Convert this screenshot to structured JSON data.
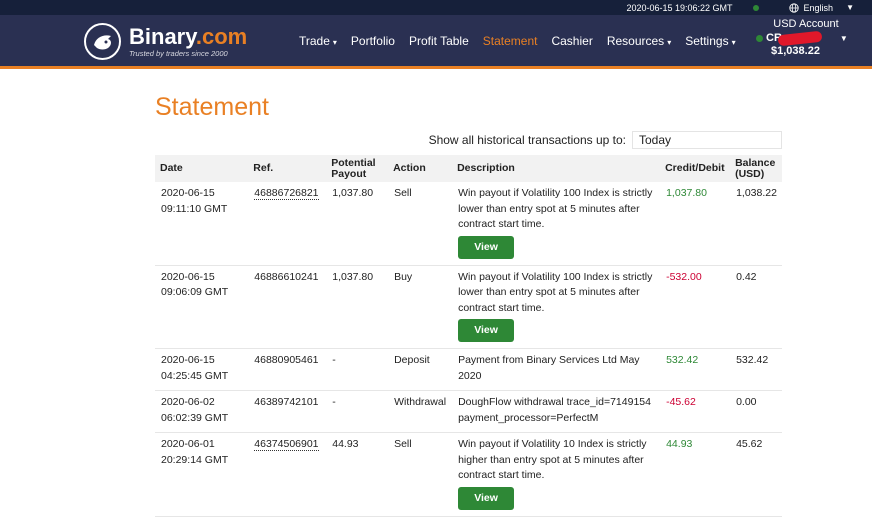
{
  "topbar": {
    "datetime": "2020-06-15 19:06:22 GMT",
    "language": "English"
  },
  "brand": {
    "name": "Binary",
    "suffix": ".com",
    "tagline": "Trusted by traders since 2000"
  },
  "nav": {
    "items": [
      {
        "label": "Trade",
        "dropdown": true,
        "active": false
      },
      {
        "label": "Portfolio",
        "dropdown": false,
        "active": false
      },
      {
        "label": "Profit Table",
        "dropdown": false,
        "active": false
      },
      {
        "label": "Statement",
        "dropdown": false,
        "active": true
      },
      {
        "label": "Cashier",
        "dropdown": false,
        "active": false
      },
      {
        "label": "Resources",
        "dropdown": true,
        "active": false
      },
      {
        "label": "Settings",
        "dropdown": true,
        "active": false
      }
    ]
  },
  "account": {
    "title": "USD Account",
    "id_prefix": "CR",
    "balance": "$1,038.22"
  },
  "page": {
    "title": "Statement",
    "filter_label": "Show all historical transactions up to:",
    "filter_value": "Today"
  },
  "table": {
    "headers": {
      "date": "Date",
      "ref": "Ref.",
      "payout": "Potential Payout",
      "action": "Action",
      "description": "Description",
      "credit": "Credit/Debit",
      "balance": "Balance (USD)"
    },
    "view_label": "View",
    "rows": [
      {
        "date": "2020-06-15",
        "time": "09:11:10 GMT",
        "ref": "46886726821",
        "ref_link": true,
        "payout": "1,037.80",
        "action": "Sell",
        "description": "Win payout if Volatility 100 Index is strictly lower than entry spot at 5 minutes after contract start time.",
        "view": true,
        "credit": "1,037.80",
        "credit_sign": "pos",
        "balance": "1,038.22"
      },
      {
        "date": "2020-06-15",
        "time": "09:06:09 GMT",
        "ref": "46886610241",
        "ref_link": false,
        "payout": "1,037.80",
        "action": "Buy",
        "description": "Win payout if Volatility 100 Index is strictly lower than entry spot at 5 minutes after contract start time.",
        "view": true,
        "credit": "-532.00",
        "credit_sign": "neg",
        "balance": "0.42"
      },
      {
        "date": "2020-06-15",
        "time": "04:25:45 GMT",
        "ref": "46880905461",
        "ref_link": false,
        "payout": "-",
        "action": "Deposit",
        "description": "Payment from Binary Services Ltd May 2020",
        "view": false,
        "credit": "532.42",
        "credit_sign": "pos",
        "balance": "532.42"
      },
      {
        "date": "2020-06-02",
        "time": "06:02:39 GMT",
        "ref": "46389742101",
        "ref_link": false,
        "payout": "-",
        "action": "Withdrawal",
        "description": "DoughFlow withdrawal trace_id=7149154 payment_processor=PerfectM",
        "view": false,
        "credit": "-45.62",
        "credit_sign": "neg",
        "balance": "0.00"
      },
      {
        "date": "2020-06-01",
        "time": "20:29:14 GMT",
        "ref": "46374506901",
        "ref_link": true,
        "payout": "44.93",
        "action": "Sell",
        "description": "Win payout if Volatility 10 Index is strictly higher than entry spot at 5 minutes after contract start time.",
        "view": true,
        "credit": "44.93",
        "credit_sign": "pos",
        "balance": "45.62"
      }
    ]
  },
  "colors": {
    "accent": "#e98024",
    "header_bg": "#2a3052",
    "topbar_bg": "#16203a",
    "positive": "#2e8836",
    "negative": "#cc0033"
  }
}
